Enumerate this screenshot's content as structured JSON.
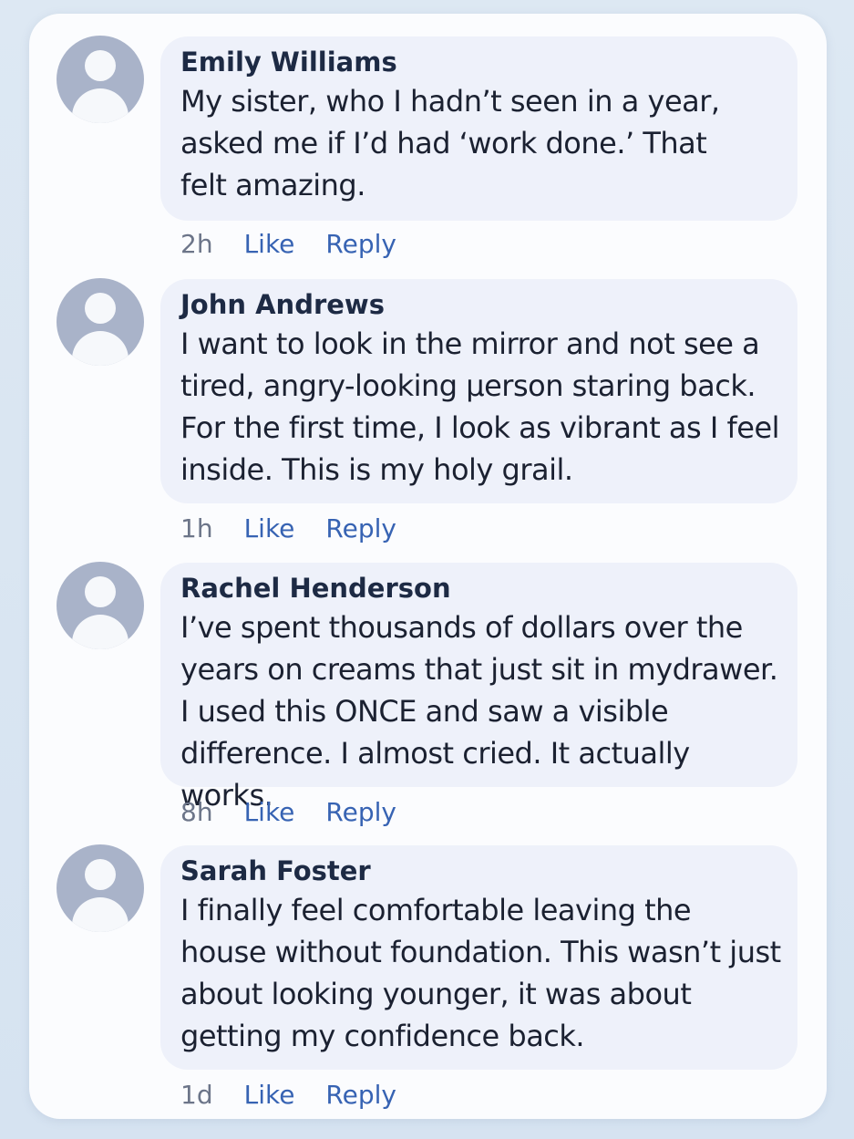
{
  "comments": [
    {
      "author": "Emily Williams",
      "text": "My sister, who I hadn’t seen in a year, asked me if I’d had ‘work done.’  That felt amazing.",
      "time": "2h",
      "like_label": "Like",
      "reply_label": "Reply"
    },
    {
      "author": "John Andrews",
      "text": "I want to look in the mirror and not see a tired, angry-looking µerson staring back. For the first time, I look as vibrant as I feel inside. This is my holy grail.",
      "time": "1h",
      "like_label": "Like",
      "reply_label": "Reply"
    },
    {
      "author": "Rachel Henderson",
      "text": "I’ve spent thousands of dollars over the years on creams that just sit in mydrawer. I used this ONCE and saw a visible difference. I almost cried. It actually works.",
      "time": "8h",
      "like_label": "Like",
      "reply_label": "Reply"
    },
    {
      "author": "Sarah Foster",
      "text": "I finally feel comfortable leaving the house without foundation. This wasn’t just about looking younger, it was about getting my confidence back.",
      "time": "1d",
      "like_label": "Like",
      "reply_label": "Reply"
    }
  ]
}
